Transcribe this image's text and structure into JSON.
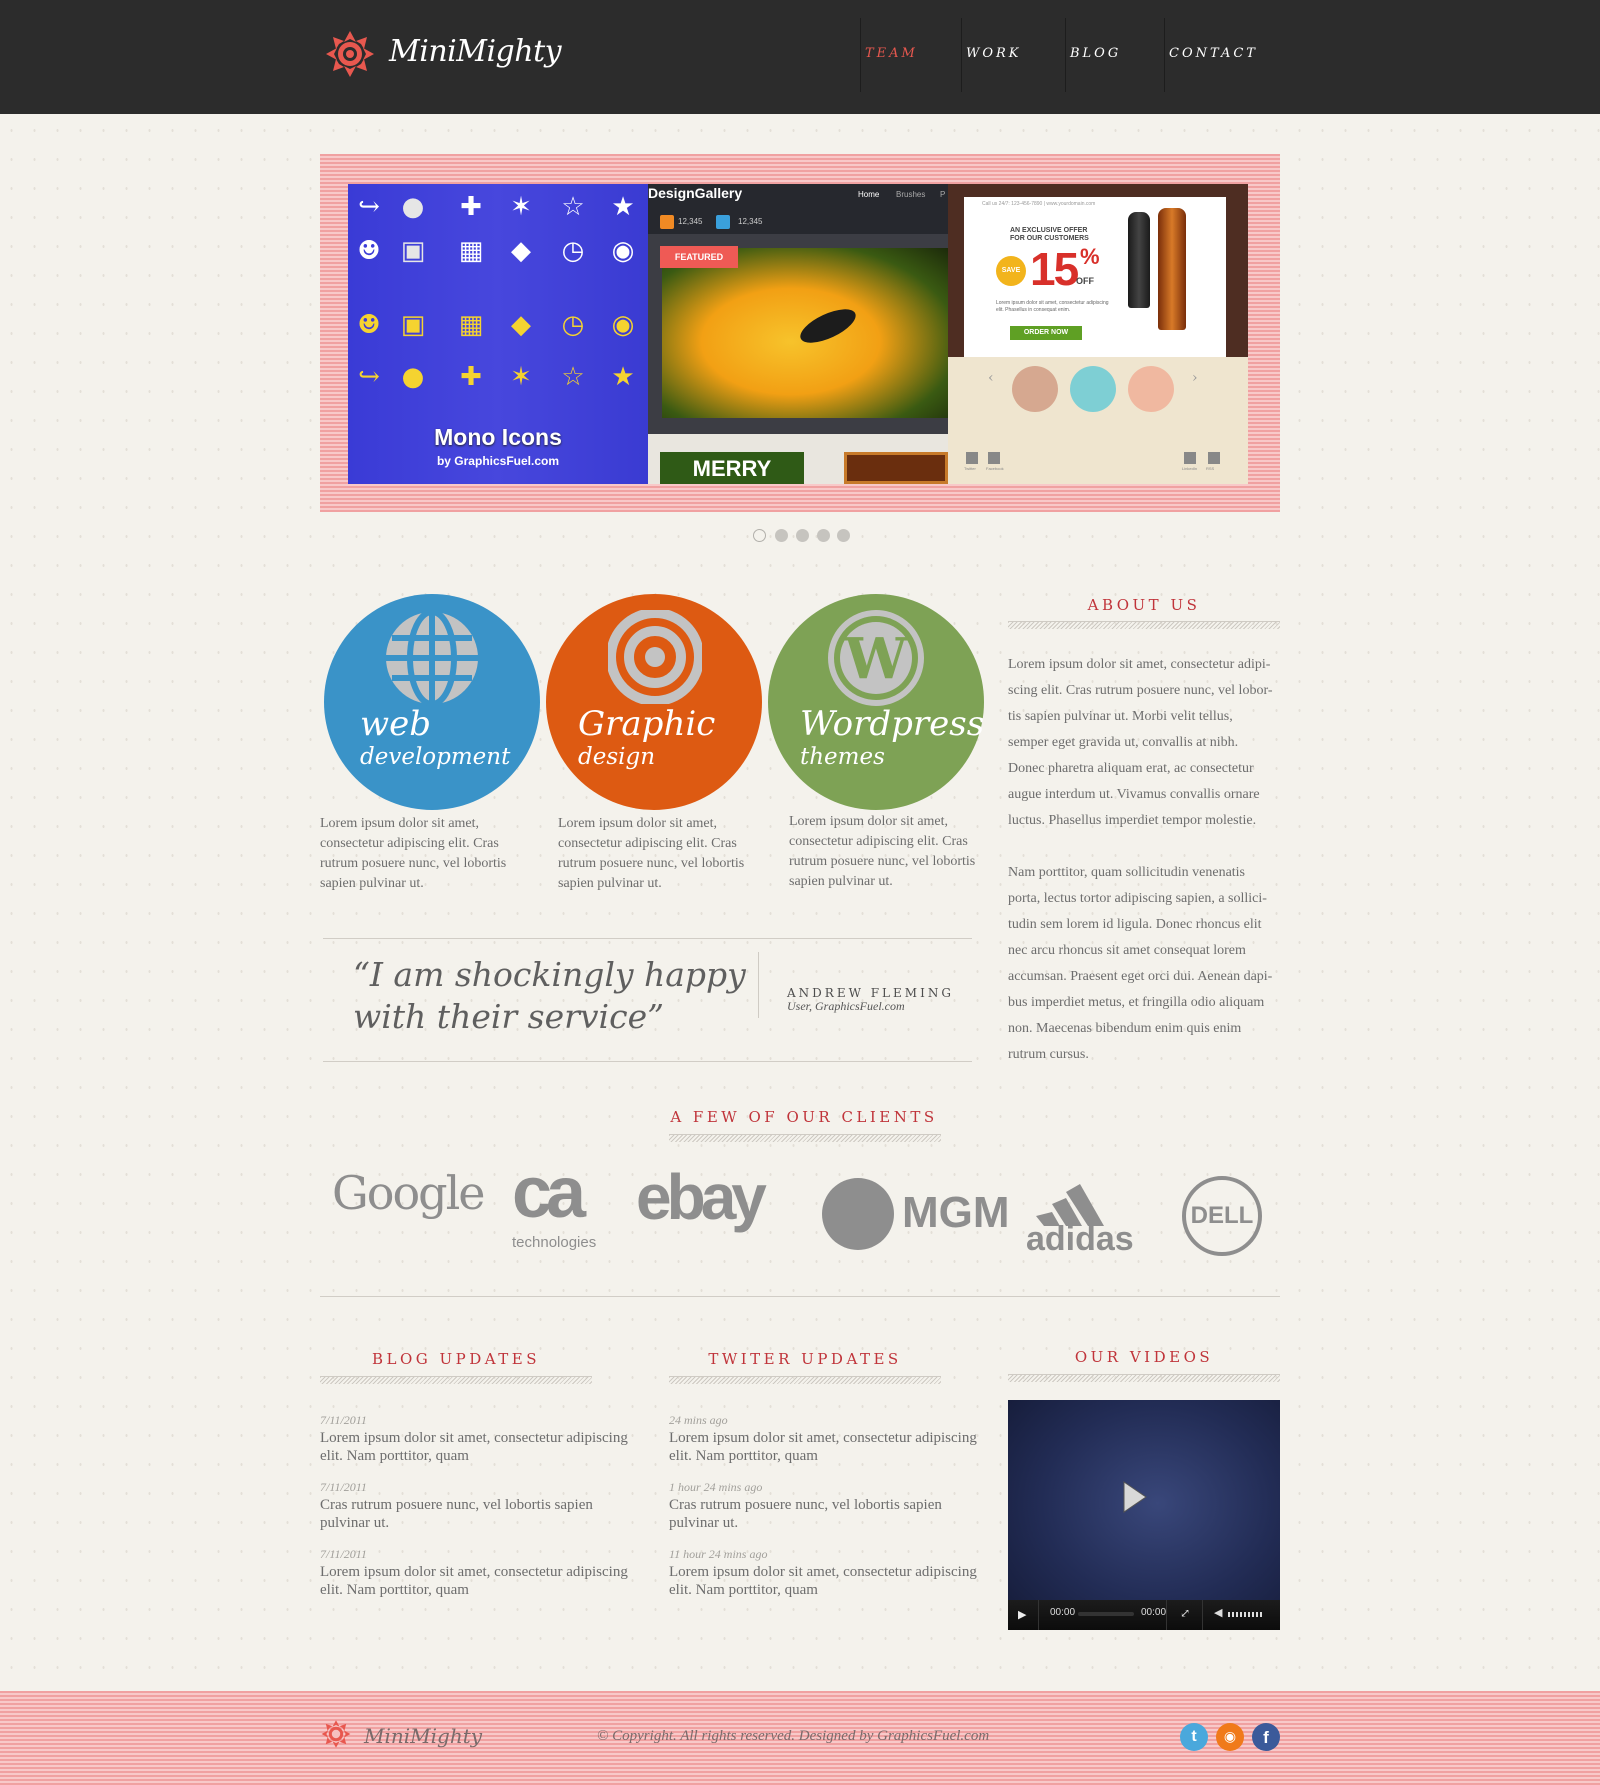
{
  "site": {
    "name": "MiniMighty"
  },
  "nav": {
    "items": [
      {
        "label": "TEAM"
      },
      {
        "label": "WORK"
      },
      {
        "label": "BLOG"
      },
      {
        "label": "CONTACT"
      }
    ],
    "active_index": 0
  },
  "slider": {
    "slide1": {
      "title": "Mono Icons",
      "subtitle": "by GraphicsFuel.com"
    },
    "slide2": {
      "brand": "DesignGallery",
      "menu": [
        "Home",
        "Brushes",
        "P"
      ],
      "rss_count": "12,345",
      "twitter_count": "12,345",
      "badge": "FEATURED",
      "card": "MERRY"
    },
    "slide3": {
      "topline": "Call us 24/7: 123-456-7890  |  www.yourdomain.com",
      "offer_line1": "AN EXCLUSIVE OFFER",
      "offer_line2": "FOR OUR CUSTOMERS",
      "save": "SAVE",
      "percent": "15",
      "percent_sign": "%",
      "off": "OFF",
      "blurb": "Lorem ipsum dolor sit amet, consectetur adipiscing elit. Phasellus in consequat enim.",
      "cta": "ORDER NOW",
      "footer_links": [
        "Twitter",
        "Facebook",
        "LinkedIn",
        "RSS"
      ]
    },
    "dots": 5,
    "active_dot": 0
  },
  "services": [
    {
      "title1": "web",
      "title2": "development",
      "color": "#3a93c8",
      "icon": "globe-icon",
      "text": "Lorem ipsum dolor sit amet, consectetur adipiscing elit. Cras rutrum posuere nunc, vel lobortis sapien pulvinar ut."
    },
    {
      "title1": "Graphic",
      "title2": "design",
      "color": "#dd5a12",
      "icon": "target-icon",
      "text": "Lorem ipsum dolor sit amet, consectetur adipiscing elit. Cras rutrum posuere nunc, vel lobortis sapien pulvinar ut."
    },
    {
      "title1": "Wordpress",
      "title2": "themes",
      "color": "#7ea255",
      "icon": "wordpress-icon",
      "text": "Lorem ipsum dolor sit amet, consectetur adipiscing elit. Cras rutrum posuere nunc, vel lobortis sapien pulvinar ut."
    }
  ],
  "about": {
    "heading": "ABOUT US",
    "paragraphs": [
      [
        "Lorem ipsum dolor sit amet, consectetur adipi-",
        "scing elit. Cras rutrum posuere nunc, vel lobor-",
        "tis sapien pulvinar ut. Morbi velit tellus,",
        "semper eget gravida ut, convallis at nibh.",
        "Donec pharetra aliquam erat, ac consectetur",
        "augue interdum ut. Vivamus convallis ornare",
        "luctus. Phasellus imperdiet tempor molestie."
      ],
      [
        "Nam porttitor, quam sollicitudin venenatis",
        "porta, lectus tortor adipiscing sapien, a sollici-",
        "tudin sem lorem id ligula. Donec rhoncus elit",
        "nec arcu rhoncus sit amet consequat lorem",
        "accumsan. Praesent eget orci dui. Aenean dapi-",
        "bus imperdiet metus, et fringilla odio aliquam",
        "non. Maecenas bibendum enim quis enim",
        "rutrum cursus."
      ]
    ]
  },
  "testimonial": {
    "quote": "“I am shockingly happy with their service”",
    "author": "ANDREW FLEMING",
    "role": "User, GraphicsFuel.com"
  },
  "clients": {
    "heading": "A FEW OF OUR CLIENTS",
    "logos": [
      "Google",
      "ca",
      "technologies",
      "ebay",
      "MGM",
      "adidas",
      "DELL"
    ]
  },
  "blog": {
    "heading": "BLOG UPDATES",
    "items": [
      {
        "date": "7/11/2011",
        "text": "Lorem ipsum dolor sit amet, consectetur adipiscing elit.  Nam porttitor, quam"
      },
      {
        "date": "7/11/2011",
        "text": "Cras rutrum posuere nunc, vel lobortis sapien pulvinar ut."
      },
      {
        "date": "7/11/2011",
        "text": "Lorem ipsum dolor sit amet, consectetur adipiscing elit.  Nam porttitor, quam"
      }
    ]
  },
  "twitter": {
    "heading": "TWITER UPDATES",
    "items": [
      {
        "date": "24 mins ago",
        "text": "Lorem ipsum dolor sit amet, consectetur adipiscing elit.  Nam porttitor, quam"
      },
      {
        "date": "1 hour 24 mins ago",
        "text": "Cras rutrum posuere nunc, vel lobortis sapien pulvinar ut."
      },
      {
        "date": "11 hour 24 mins ago",
        "text": "Lorem ipsum dolor sit amet, consectetur adipiscing elit.  Nam porttitor, quam"
      }
    ]
  },
  "videos": {
    "heading": "OUR VIDEOS",
    "time_current": "00:00",
    "time_total": "00:00"
  },
  "footer": {
    "logo": "MiniMighty",
    "copyright": "© Copyright. All rights reserved. Designed by GraphicsFuel.com",
    "social": [
      "twitter-icon",
      "rss-icon",
      "facebook-icon"
    ]
  },
  "colors": {
    "accent": "#e8584f",
    "heading": "#c0343a",
    "header_bg": "#2c2c2c"
  }
}
